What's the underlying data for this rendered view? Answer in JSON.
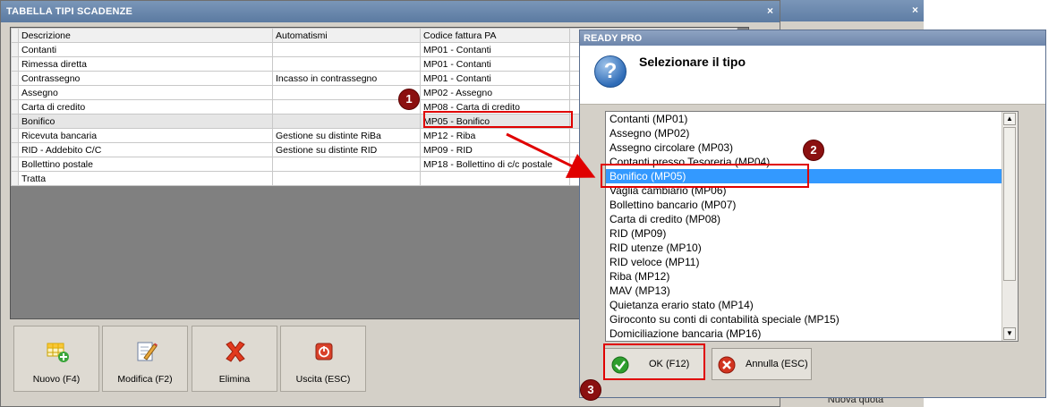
{
  "main_window": {
    "title": "TABELLA TIPI SCADENZE",
    "close_glyph": "×",
    "columns": [
      "Descrizione",
      "Automatismi",
      "Codice fattura PA"
    ],
    "rows": [
      {
        "descrizione": "Contanti",
        "automatismi": "",
        "codice": "MP01 - Contanti"
      },
      {
        "descrizione": "Rimessa diretta",
        "automatismi": "",
        "codice": "MP01 - Contanti"
      },
      {
        "descrizione": "Contrassegno",
        "automatismi": "Incasso in contrassegno",
        "codice": "MP01 - Contanti"
      },
      {
        "descrizione": "Assegno",
        "automatismi": "",
        "codice": "MP02 - Assegno"
      },
      {
        "descrizione": "Carta di credito",
        "automatismi": "",
        "codice": "MP08 - Carta di credito"
      },
      {
        "descrizione": "Bonifico",
        "automatismi": "",
        "codice": "MP05 - Bonifico"
      },
      {
        "descrizione": "Ricevuta bancaria",
        "automatismi": "Gestione su distinte RiBa",
        "codice": "MP12 - Riba"
      },
      {
        "descrizione": "RID - Addebito C/C",
        "automatismi": "Gestione su distinte RID",
        "codice": "MP09 - RID"
      },
      {
        "descrizione": "Bollettino postale",
        "automatismi": "",
        "codice": "MP18 - Bollettino di c/c postale"
      },
      {
        "descrizione": "Tratta",
        "automatismi": "",
        "codice": ""
      }
    ],
    "buttons": {
      "new": "Nuovo (F4)",
      "edit": "Modifica (F2)",
      "delete": "Elimina",
      "exit": "Uscita (ESC)"
    }
  },
  "back_window": {
    "close_glyph": "×",
    "button_label": "Nuova quota"
  },
  "dialog": {
    "title": "READY PRO",
    "prompt": "Selezionare il tipo",
    "question_glyph": "?",
    "items": [
      "Contanti (MP01)",
      "Assegno (MP02)",
      "Assegno circolare (MP03)",
      "Contanti presso Tesoreria (MP04)",
      "Bonifico (MP05)",
      "Vaglia cambiario (MP06)",
      "Bollettino bancario (MP07)",
      "Carta di credito (MP08)",
      "RID (MP09)",
      "RID utenze (MP10)",
      "RID veloce (MP11)",
      "Riba (MP12)",
      "MAV (MP13)",
      "Quietanza erario stato (MP14)",
      "Giroconto su conti di contabilità speciale (MP15)",
      "Domiciliazione bancaria (MP16)"
    ],
    "selected_item": "Bonifico (MP05)",
    "ok_label": "OK (F12)",
    "cancel_label": "Annulla (ESC)"
  },
  "annotations": {
    "badge1": "1",
    "badge2": "2",
    "badge3": "3",
    "color": "#e00000"
  }
}
